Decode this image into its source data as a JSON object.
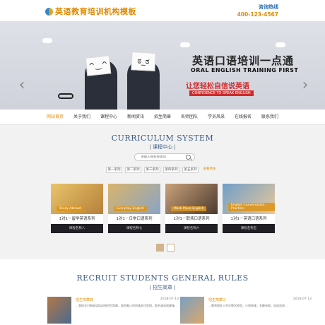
{
  "header": {
    "logo_text": "英语教育培训机构模板",
    "hotline_label": "咨询热线",
    "hotline_number": "400-123-4567"
  },
  "banner": {
    "title": "英语口语培训一点通",
    "subtitle": "ORAL ENGLISH TRAINING FIRST",
    "slogan": "让您轻松自信说英语",
    "slogan_en": "CONFIDENCE TO SPEAK ENGLISH",
    "prev_icon": "chevron-left-icon",
    "next_icon": "chevron-right-icon"
  },
  "nav": {
    "items": [
      "网站首页",
      "关于我们",
      "课程中心",
      "新闻资讯",
      "招生简章",
      "名师团队",
      "学员风采",
      "在线报名",
      "联系我们"
    ],
    "active_index": 0,
    "accent_color": "#e38b00"
  },
  "curriculum": {
    "title": "CURRICULUM SYSTEM",
    "subtitle": "| 课程中心 |",
    "search_placeholder": "请输入搜索关键词",
    "tabs": [
      "第一系列",
      "第二系列",
      "第三系列",
      "第四系列",
      "第五系列",
      "查看更多"
    ],
    "cards": [
      {
        "caption": "1对1－留学英语系列",
        "name": "课程名称八",
        "tag": "Study Abroad"
      },
      {
        "caption": "1对1－日常口语系列",
        "name": "课程名称七",
        "tag": "Everyday English"
      },
      {
        "caption": "1对1－职场口语系列",
        "name": "课程名称六",
        "tag": "Work Place English"
      },
      {
        "caption": "1对1－英语口语系列",
        "name": "课程名称五",
        "tag": "English Conversation Practice"
      }
    ],
    "pager_active": 1
  },
  "recruit": {
    "title": "RECRUIT STUDENTS GENERAL RULES",
    "subtitle": "| 招生简章 |",
    "news": [
      {
        "title": "招生简章四",
        "date": "2018-07-13",
        "body": "…我校全日制英语培训班招生简章，报名截止时间请关注官网，报名请咨询客服…"
      },
      {
        "title": "招生简章三",
        "date": "2018-07-13",
        "body": "…教师团队十余年教学经验，小班授课，名额有限，欢迎咨询…"
      }
    ]
  }
}
